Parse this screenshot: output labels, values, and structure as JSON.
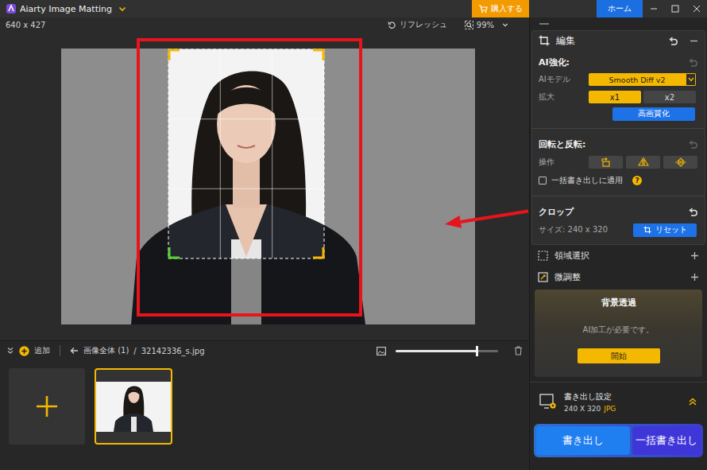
{
  "window": {
    "title": "Aiarty Image Matting",
    "buy_button": "購入する",
    "home_button": "ホーム"
  },
  "toolbar": {
    "dimensions": "640 x 427",
    "refresh": "リフレッシュ",
    "zoom": "99%"
  },
  "filmstrip": {
    "add": "追加",
    "breadcrumb_root": "画像全体 (1)",
    "separator": "/",
    "file": "32142336_s.jpg",
    "thumb_size_level": 0.79,
    "thumbnails": [
      {
        "selected": true
      }
    ]
  },
  "edit_panel": {
    "title": "編集",
    "expanded": true,
    "undo_enabled": true,
    "ai": {
      "heading": "AI強化:",
      "undo_enabled": false,
      "model_label": "AIモデル",
      "model": "Smooth Diff v2",
      "scale_label": "拡大",
      "scales": [
        {
          "label": "x1",
          "selected": true
        },
        {
          "label": "x2",
          "selected": false
        }
      ],
      "enhance_button": "高画質化"
    },
    "rotate": {
      "heading": "回転と反転:",
      "undo_enabled": false,
      "label": "操作",
      "batch_label": "一括書き出しに適用",
      "batch_checked": false,
      "help": "?"
    },
    "crop": {
      "heading": "クロップ",
      "undo_enabled": true,
      "size": "サイズ: 240 x 320",
      "reset": "リセット"
    }
  },
  "sections": [
    {
      "label": "領域選択",
      "expanded": false
    },
    {
      "label": "微調整",
      "expanded": false
    }
  ],
  "background": {
    "title": "背景透過",
    "message": "AI加工が必要です。",
    "start": "開始"
  },
  "export": {
    "title": "書き出し設定",
    "size": "240 X 320",
    "format": "JPG",
    "buttons": [
      {
        "label": "書き出し",
        "color": "#1f7ef0"
      },
      {
        "label": "一括書き出し",
        "color": "#3f36d9"
      }
    ]
  }
}
